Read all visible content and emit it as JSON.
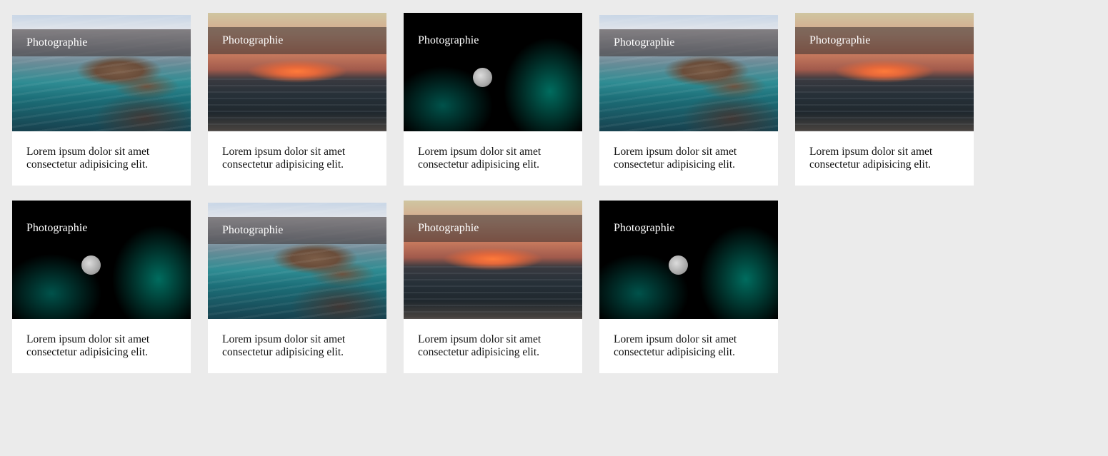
{
  "cards": [
    {
      "overlay": "Photographie",
      "text": "Lorem ipsum dolor sit amet consectetur adipisicing elit.",
      "image": "rocks-sea-photo"
    },
    {
      "overlay": "Photographie",
      "text": "Lorem ipsum dolor sit amet consectetur adipisicing elit.",
      "image": "sunset-sea-photo"
    },
    {
      "overlay": "Photographie",
      "text": "Lorem ipsum dolor sit amet consectetur adipisicing elit.",
      "image": "moon-night-photo"
    },
    {
      "overlay": "Photographie",
      "text": "Lorem ipsum dolor sit amet consectetur adipisicing elit.",
      "image": "rocks-sea-photo"
    },
    {
      "overlay": "Photographie",
      "text": "Lorem ipsum dolor sit amet consectetur adipisicing elit.",
      "image": "sunset-sea-photo"
    },
    {
      "overlay": "Photographie",
      "text": "Lorem ipsum dolor sit amet consectetur adipisicing elit.",
      "image": "moon-night-photo"
    },
    {
      "overlay": "Photographie",
      "text": "Lorem ipsum dolor sit amet consectetur adipisicing elit.",
      "image": "rocks-sea-photo"
    },
    {
      "overlay": "Photographie",
      "text": "Lorem ipsum dolor sit amet consectetur adipisicing elit.",
      "image": "sunset-sea-photo"
    },
    {
      "overlay": "Photographie",
      "text": "Lorem ipsum dolor sit amet consectetur adipisicing elit.",
      "image": "moon-night-photo"
    }
  ],
  "colors": {
    "background": "#ebebeb",
    "card": "#ffffff",
    "overlay": "rgba(55,45,45,0.55)"
  }
}
